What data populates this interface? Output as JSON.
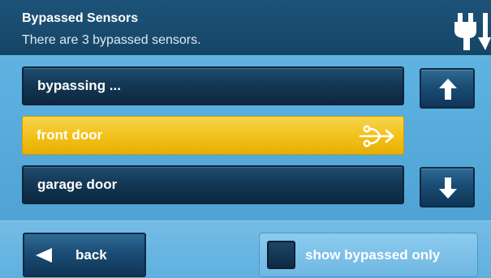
{
  "header": {
    "title": "Bypassed Sensors",
    "subtitle": "There are 3 bypassed sensors.",
    "status_icon": "power-plug-icon"
  },
  "list": {
    "rows": [
      {
        "label": "bypassing ...",
        "state": "normal"
      },
      {
        "label": "front door",
        "state": "selected",
        "icon": "bypass-route-icon"
      },
      {
        "label": "garage door",
        "state": "normal"
      }
    ],
    "scroll_up_icon": "arrow-up-icon",
    "scroll_down_icon": "arrow-down-icon"
  },
  "footer": {
    "back_label": "back",
    "back_icon": "triangle-left-icon",
    "filter_label": "show bypassed only",
    "filter_checked": false
  },
  "colors": {
    "background": "#5aaedd",
    "header": "#1a4d70",
    "row_normal": "#143855",
    "row_selected": "#f2c21c"
  }
}
